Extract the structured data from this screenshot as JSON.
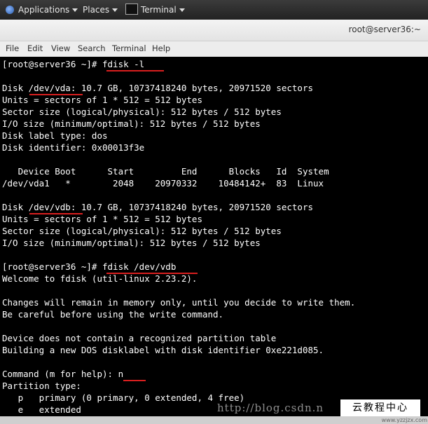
{
  "topbar": {
    "applications": "Applications",
    "places": "Places",
    "terminal_task": "Terminal"
  },
  "window": {
    "title": "root@server36:~"
  },
  "menubar": {
    "items": [
      "File",
      "Edit",
      "View",
      "Search",
      "Terminal",
      "Help"
    ]
  },
  "terminal": {
    "lines": [
      "[root@server36 ~]# fdisk -l",
      "",
      "Disk /dev/vda: 10.7 GB, 10737418240 bytes, 20971520 sectors",
      "Units = sectors of 1 * 512 = 512 bytes",
      "Sector size (logical/physical): 512 bytes / 512 bytes",
      "I/O size (minimum/optimal): 512 bytes / 512 bytes",
      "Disk label type: dos",
      "Disk identifier: 0x00013f3e",
      "",
      "   Device Boot      Start         End      Blocks   Id  System",
      "/dev/vda1   *        2048    20970332    10484142+  83  Linux",
      "",
      "Disk /dev/vdb: 10.7 GB, 10737418240 bytes, 20971520 sectors",
      "Units = sectors of 1 * 512 = 512 bytes",
      "Sector size (logical/physical): 512 bytes / 512 bytes",
      "I/O size (minimum/optimal): 512 bytes / 512 bytes",
      "",
      "[root@server36 ~]# fdisk /dev/vdb",
      "Welcome to fdisk (util-linux 2.23.2).",
      "",
      "Changes will remain in memory only, until you decide to write them.",
      "Be careful before using the write command.",
      "",
      "Device does not contain a recognized partition table",
      "Building a new DOS disklabel with disk identifier 0xe221d085.",
      "",
      "Command (m for help): n",
      "Partition type:",
      "   p   primary (0 primary, 0 extended, 4 free)",
      "   e   extended"
    ]
  },
  "watermark": {
    "url": "http://blog.csdn.n",
    "brand": "云教程中心",
    "site": "www.yzzjzx.com"
  }
}
